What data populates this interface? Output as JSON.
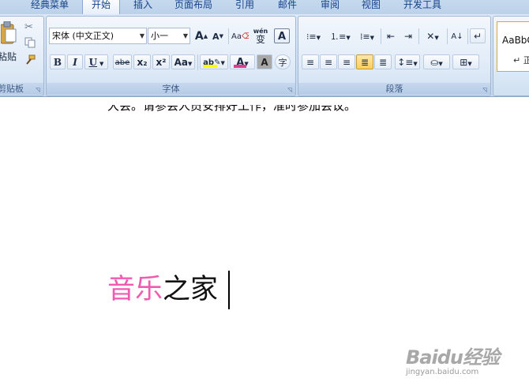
{
  "tabs": [
    {
      "label": "经典菜单",
      "active": false
    },
    {
      "label": "开始",
      "active": true
    },
    {
      "label": "插入",
      "active": false
    },
    {
      "label": "页面布局",
      "active": false
    },
    {
      "label": "引用",
      "active": false
    },
    {
      "label": "邮件",
      "active": false
    },
    {
      "label": "审阅",
      "active": false
    },
    {
      "label": "视图",
      "active": false
    },
    {
      "label": "开发工具",
      "active": false
    }
  ],
  "clipboard": {
    "paste_label": "粘贴",
    "group_label": "剪贴板"
  },
  "font": {
    "font_name": "宋体 (中文正文)",
    "font_size": "小一",
    "grow_label": "A",
    "shrink_label": "A",
    "clear_format_label": "Aa",
    "phonetic_label": "wén",
    "phonetic_char": "变",
    "border_char_label": "A",
    "bold_label": "B",
    "italic_label": "I",
    "underline_label": "U",
    "strike_label": "abe",
    "subscript_label": "x₂",
    "superscript_label": "x²",
    "change_case_label": "Aa",
    "highlight_label": "ab",
    "font_color_label": "A",
    "shading_label": "A",
    "enclose_label": "字",
    "group_label": "字体",
    "highlight_color": "#ffff00",
    "font_color": "#e23a8d"
  },
  "paragraph": {
    "group_label": "段落"
  },
  "styles": {
    "sample_text": "AaBbC",
    "style_name": "↵ 正"
  },
  "document": {
    "line_text": "大会。请参会人员安排好工作，准时参加会议。",
    "title_colored": "音乐",
    "title_rest": "之家",
    "title_color": "#f05bb0"
  },
  "watermark": {
    "logo": "Baidu经验",
    "url": "jingyan.baidu.com"
  }
}
